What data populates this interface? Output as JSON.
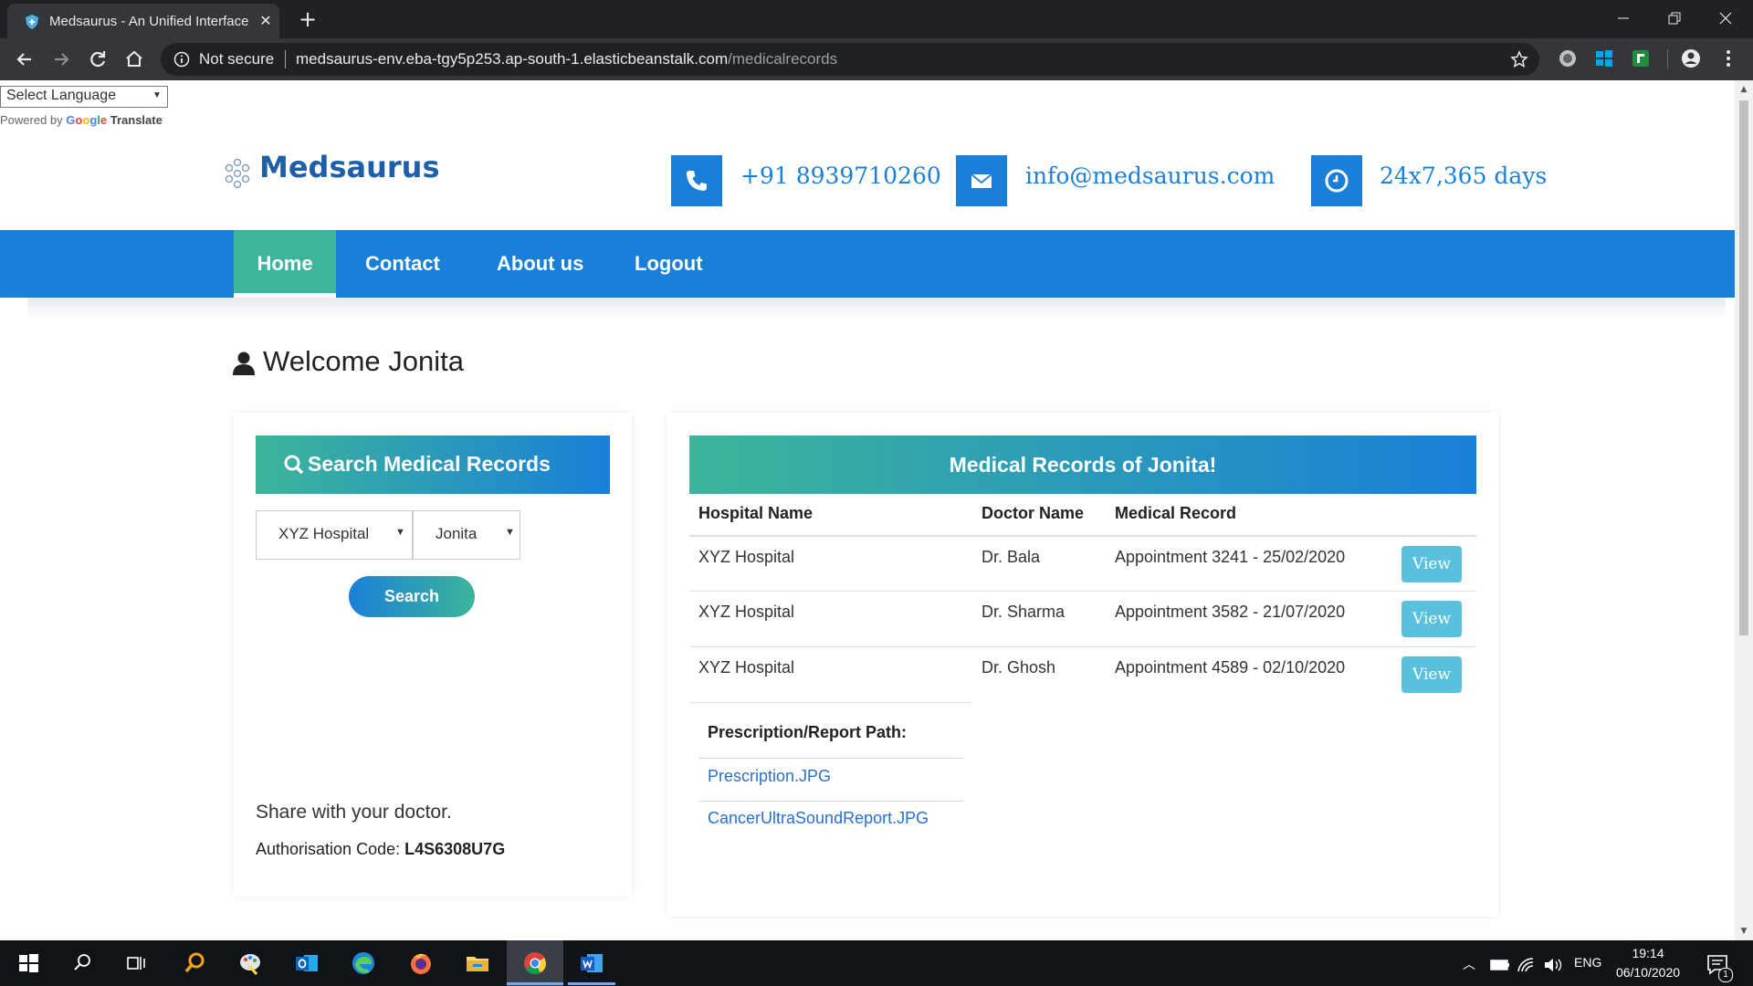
{
  "browser": {
    "tab_title": "Medsaurus - An Unified Interface for Medical Records",
    "security_label": "Not secure",
    "url_host": "medsaurus-env.eba-tgy5p253.ap-south-1.elasticbeanstalk.com",
    "url_path": "/medicalrecords"
  },
  "translate": {
    "select_label": "Select Language",
    "powered_by": "Powered by",
    "google": "Google",
    "translate": "Translate"
  },
  "header": {
    "brand": "Medsaurus",
    "phone": "+91 8939710260",
    "email": "info@medsaurus.com",
    "hours": "24x7,365 days"
  },
  "nav": {
    "items": [
      "Home",
      "Contact",
      "About us",
      "Logout"
    ]
  },
  "welcome": "Welcome Jonita",
  "search_panel": {
    "title": "Search Medical Records",
    "hospital_value": "XYZ Hospital",
    "patient_value": "Jonita",
    "search_label": "Search",
    "share_text": "Share with your doctor.",
    "auth_label": "Authorisation Code:",
    "auth_code": "L4S6308U7G"
  },
  "records_panel": {
    "title": "Medical Records of Jonita!",
    "columns": [
      "Hospital Name",
      "Doctor Name",
      "Medical Record"
    ],
    "rows": [
      {
        "hospital": "XYZ Hospital",
        "doctor": "Dr. Bala",
        "record": "Appointment 3241 - 25/02/2020",
        "action": "View"
      },
      {
        "hospital": "XYZ Hospital",
        "doctor": "Dr. Sharma",
        "record": "Appointment 3582 - 21/07/2020",
        "action": "View"
      },
      {
        "hospital": "XYZ Hospital",
        "doctor": "Dr. Ghosh",
        "record": "Appointment 4589 - 02/10/2020",
        "action": "View"
      }
    ],
    "prescription_title": "Prescription/Report Path:",
    "files": [
      "Prescription.JPG",
      "CancerUltraSoundReport.JPG"
    ]
  },
  "taskbar": {
    "language": "ENG",
    "time": "19:14",
    "date": "06/10/2020",
    "notification_count": "1"
  },
  "colors": {
    "brand_blue": "#1a7fd8",
    "brand_green": "#3db59a",
    "view_button": "#5bc0de"
  }
}
